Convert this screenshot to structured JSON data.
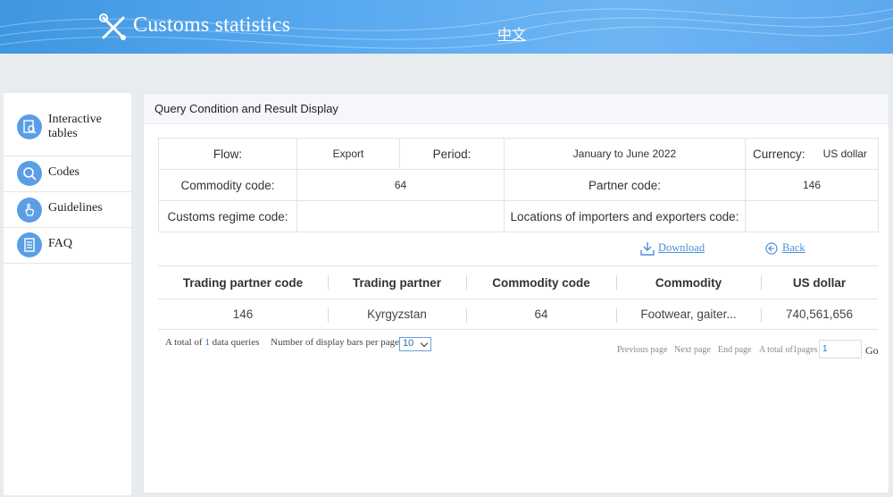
{
  "header": {
    "title": "Customs statistics",
    "lang_link": "中文",
    "logo_icon": "tools-icon",
    "colors": {
      "bar": "#4f9fe8"
    }
  },
  "sidebar": {
    "items": [
      {
        "label": "Interactive tables",
        "icon": "table-search-icon"
      },
      {
        "label": "Codes",
        "icon": "search-icon"
      },
      {
        "label": "Guidelines",
        "icon": "hand-pointer-icon"
      },
      {
        "label": "FAQ",
        "icon": "list-document-icon"
      }
    ]
  },
  "panel": {
    "title": "Query Condition and Result Display"
  },
  "query": {
    "flow_label": "Flow:",
    "flow_value": "Export",
    "period_label": "Period:",
    "period_value": "January to June 2022",
    "currency_label": "Currency:",
    "currency_value": "US dollar",
    "commodity_code_label": "Commodity code:",
    "commodity_code_value": "64",
    "partner_code_label": "Partner code:",
    "partner_code_value": "146",
    "customs_regime_label": "Customs regime code:",
    "customs_regime_value": "",
    "locations_label": "Locations of importers and exporters code:",
    "locations_value": ""
  },
  "actions": {
    "download": "Download",
    "back": "Back"
  },
  "results": {
    "headers": [
      "Trading partner code",
      "Trading partner",
      "Commodity code",
      "Commodity",
      "US dollar"
    ],
    "rows": [
      [
        "146",
        "Kyrgyzstan",
        "64",
        "Footwear, gaiter...",
        "740,561,656"
      ]
    ]
  },
  "footer": {
    "total_prefix": "A total of",
    "total_count": "1",
    "total_suffix": "data queries",
    "per_page_label": "Number of display bars per page",
    "per_page_value": "10",
    "prev": "Previous page",
    "next": "Next page",
    "end": "End page",
    "total_pages": "A total of1pages",
    "page_input": "1",
    "go": "Go"
  }
}
